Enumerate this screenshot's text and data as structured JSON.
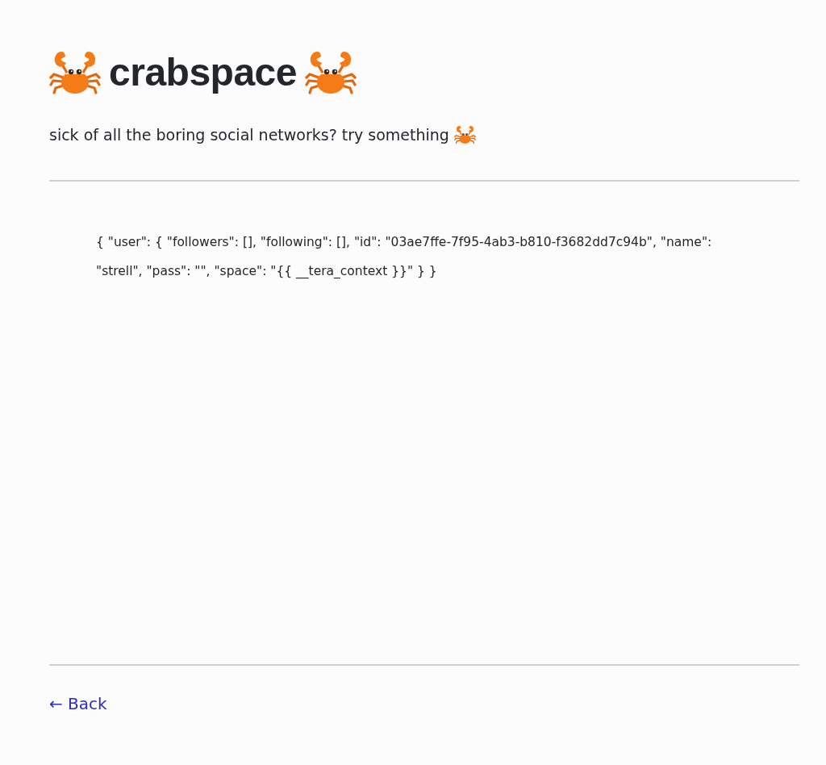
{
  "header": {
    "title": "crabspace",
    "tagline": "sick of all the boring social networks? try something"
  },
  "content": {
    "text": "{ \"user\": { \"followers\": [], \"following\": [], \"id\": \"03ae7ffe-7f95-4ab3-b810-f3682dd7c94b\", \"name\": \"strell\", \"pass\": \"\", \"space\": \"{{ __tera_context }}\" } }"
  },
  "footer": {
    "back_link": "← Back"
  }
}
